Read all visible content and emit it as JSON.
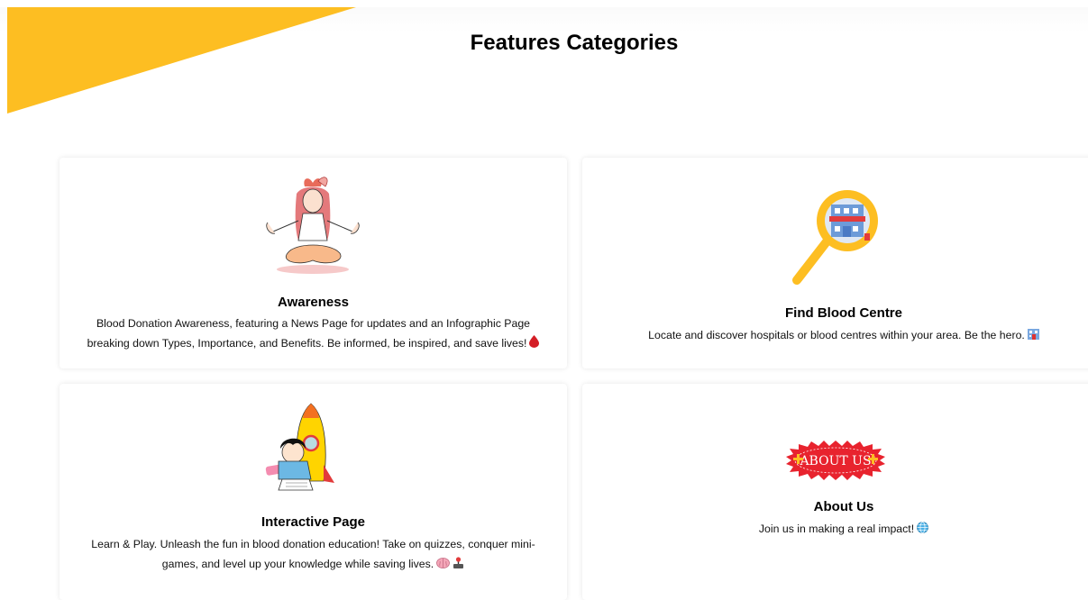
{
  "page": {
    "title": "Features Categories",
    "accent_color": "#FDBE22"
  },
  "cards": {
    "awareness": {
      "title": "Awareness",
      "description": "Blood Donation Awareness, featuring a News Page for updates and an Infographic Page breaking down Types, Importance, and Benefits. Be informed, be inspired, and save lives!",
      "illustration": "meditating-person-illustration",
      "emoji": "blood-drop-icon"
    },
    "find_blood_centre": {
      "title": "Find Blood Centre",
      "description": "Locate and discover hospitals or blood centres within your area. Be the hero.",
      "illustration": "magnifier-hospital-illustration",
      "emoji": "hospital-icon"
    },
    "interactive": {
      "title": "Interactive Page",
      "description": "Learn & Play. Unleash the fun in blood donation education! Take on quizzes, conquer mini-games, and level up your knowledge while saving lives.",
      "illustration": "child-rocket-illustration",
      "emoji": [
        "brain-icon",
        "joystick-icon"
      ]
    },
    "about": {
      "title": "About Us",
      "description": "Join us in making a real impact!",
      "badge_text": "ABOUT US",
      "illustration": "about-us-badge",
      "emoji": "globe-icon"
    }
  }
}
